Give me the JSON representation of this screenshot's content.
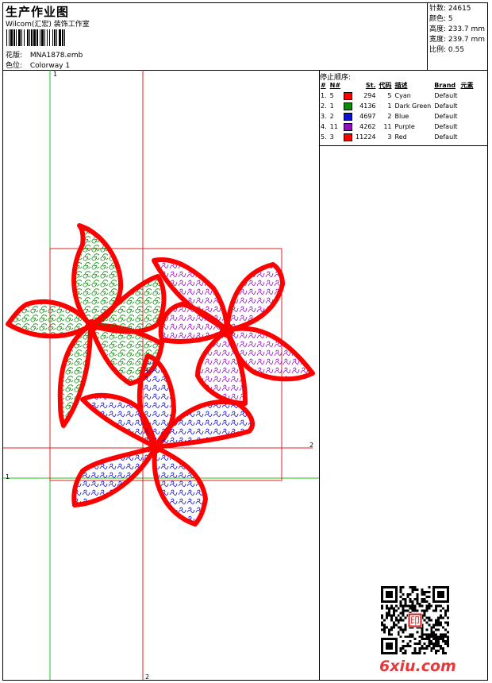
{
  "header": {
    "title": "生产作业图",
    "company": "Wilcom(汇宏) 装饰工作室",
    "design_label": "花版:",
    "design_value": "MNA1878.emb",
    "colorway_label": "色位:",
    "colorway_value": "Colorway 1"
  },
  "stats": {
    "stitches": "针数: 24615",
    "colors": "颜色: 5",
    "height": "高度: 233.7 mm",
    "width": "宽度: 239.7 mm",
    "scale": "比例: 0.55"
  },
  "stop_sequence": {
    "title": "停止顺序:",
    "columns": [
      "#",
      "N#",
      "St.",
      "代码",
      "描述",
      "Brand",
      "元素"
    ],
    "rows": [
      {
        "idx": "1.",
        "n": "5",
        "color": "#ff0000",
        "st": "294",
        "code": "5",
        "desc": "Cyan",
        "brand": "Default"
      },
      {
        "idx": "2.",
        "n": "1",
        "color": "#0a8a0a",
        "st": "4136",
        "code": "1",
        "desc": "Dark Green",
        "brand": "Default"
      },
      {
        "idx": "3.",
        "n": "2",
        "color": "#1010d0",
        "st": "4697",
        "code": "2",
        "desc": "Blue",
        "brand": "Default"
      },
      {
        "idx": "4.",
        "n": "11",
        "color": "#9010c0",
        "st": "4262",
        "code": "11",
        "desc": "Purple",
        "brand": "Default"
      },
      {
        "idx": "5.",
        "n": "3",
        "color": "#ff0000",
        "st": "11224",
        "code": "3",
        "desc": "Red",
        "brand": "Default"
      }
    ]
  },
  "axes": {
    "v1": "1",
    "h1": "1",
    "v2": "2",
    "h2": "2"
  },
  "watermark": "6xiu.com",
  "qr_stamp_text": "印"
}
